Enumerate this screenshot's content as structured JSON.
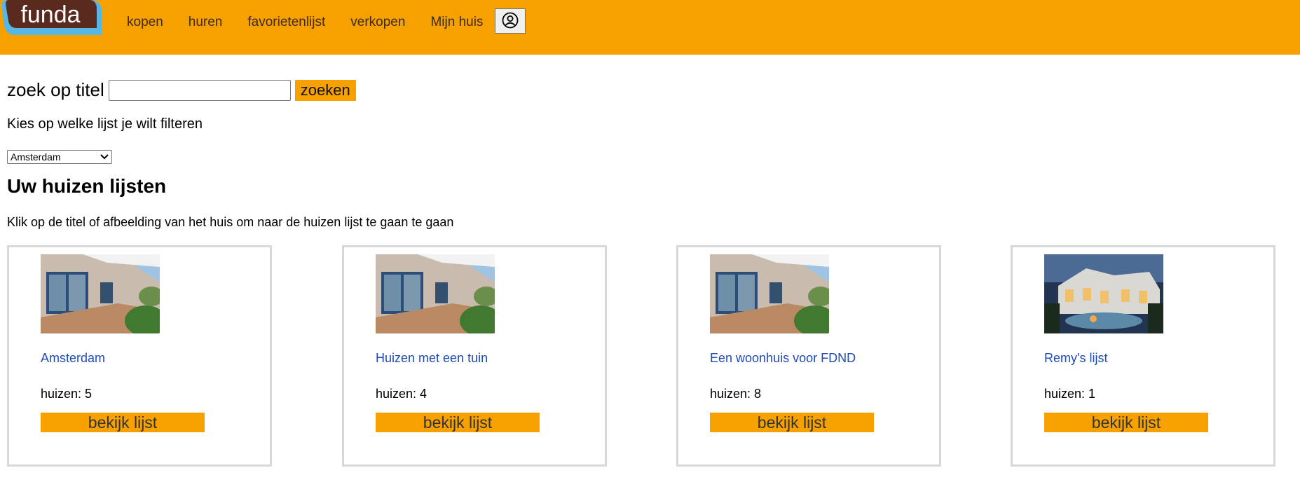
{
  "header": {
    "logo_text": "funda",
    "nav": [
      "kopen",
      "huren",
      "favorietenlijst",
      "verkopen",
      "Mijn huis"
    ],
    "account_icon": "user-circle-icon",
    "accent_color": "#f7a100"
  },
  "search": {
    "label": "zoek op titel",
    "value": "",
    "button_label": "zoeken"
  },
  "filter": {
    "prompt": "Kies op welke lijst je wilt filteren",
    "selected": "Amsterdam"
  },
  "page": {
    "title": "Uw huizen lijsten",
    "instruction": "Klik op de titel of afbeelding van het huis om naar de huizen lijst te gaan te gaan"
  },
  "lists": [
    {
      "title": "Amsterdam",
      "count_label": "huizen:",
      "count": "5",
      "button_label": "bekijk lijst",
      "image": "house-patio-photo"
    },
    {
      "title": "Huizen met een tuin",
      "count_label": "huizen:",
      "count": "4",
      "button_label": "bekijk lijst",
      "image": "house-patio-photo"
    },
    {
      "title": "Een woonhuis voor FDND",
      "count_label": "huizen:",
      "count": "8",
      "button_label": "bekijk lijst",
      "image": "house-patio-photo"
    },
    {
      "title": "Remy's lijst",
      "count_label": "huizen:",
      "count": "1",
      "button_label": "bekijk lijst",
      "image": "villa-night-photo"
    }
  ]
}
